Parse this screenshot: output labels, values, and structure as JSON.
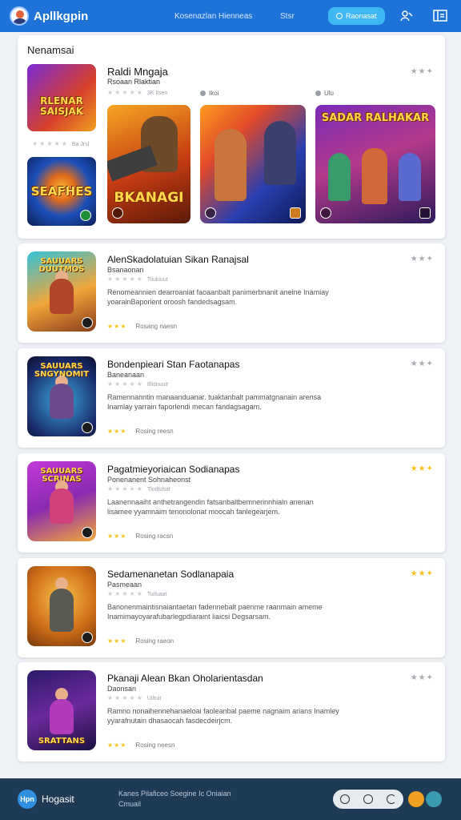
{
  "header": {
    "app_title": "Apllkgpin",
    "nav_link_1": "Kosenazlan Hienneas",
    "nav_link_2": "Stsr",
    "cta_label": "Raonasat"
  },
  "featured": {
    "section_title": "Nenamsai",
    "side_card_1_title": "RLENAR SAISJAK",
    "side_card_1_meta": "Ba Jrsl",
    "side_card_2_title": "SEAFHES",
    "game_title": "Raldi Mngaja",
    "game_subtitle": "Rsoaan Rlaktian",
    "rating_text": "3K Ilsen",
    "tag_1": "Ikoi",
    "tag_2": "Ulu",
    "art_1_title": "BKANAGI",
    "art_3_title": "SADAR RALHAKAR"
  },
  "list": [
    {
      "title": "AlenSkadolatuian Sikan Ranajsal",
      "developer": "Bsanaonan",
      "meta": "Tilukiuut",
      "description": "Renomeannien dearroaniat faoaanbalt panimerbnanit aneine Inamiay yoarainBaporient oroosh fandedsagsam.",
      "rating_text": "Rosang naesn",
      "rating_stars": 3,
      "thumb_title": "SAUUARS DUUTMOS"
    },
    {
      "title": "Bondenpieari Stan Faotanapas",
      "developer": "Baneanaan",
      "meta": "Ifildnuuit",
      "description": "Ramennanntin manaanduanar. tuaktanbalt pammatgnanain arensa Inamlay yarrain faporlendi mecan fandagsagam.",
      "rating_text": "Rosing reesn",
      "rating_stars": 3,
      "thumb_title": "SAUUARS SNGYNOMIT"
    },
    {
      "title": "Pagatmieyoriaican Sodianapas",
      "developer": "Ponenanent Sohnaheonst",
      "meta": "Tlodtusat",
      "description": "Laanennaaiht anthetrangendin fatsanbaltbemnerinnhialn anenan lisamee yyamnaim tenonolonat moocah fanlegearjem.",
      "rating_text": "Rosing racsn",
      "rating_stars": 3,
      "thumb_title": "SAUUARS SCRINAS"
    },
    {
      "title": "Sedamenanetan Sodlanapaia",
      "developer": "Pasmeaan",
      "meta": "Tuiluaat",
      "description": "Banonenmaintisnaiantaetan fadennebalt paenme raanmain ameme Inamimayoyarafubarlegpdiaraint liaicsi Degsarsam.",
      "rating_text": "Rosing raeon",
      "rating_stars": 3,
      "thumb_title": ""
    },
    {
      "title": "Pkanaji Alean Bkan Oholarientasdan",
      "developer": "Daonsan",
      "meta": "Uiltuit",
      "description": "Ramno nonaihennehanaeloai faoleanbal paeme nagnaim arians Inamley yyarafnutain dhasaocah fasdecdeirjcm.",
      "rating_text": "Rosing neesn",
      "rating_stars": 3,
      "thumb_title": "SRATTANS"
    }
  ],
  "footer": {
    "logo_text": "Hpn",
    "brand": "Hogasit",
    "links_line_1": "Kanes Pilaficeo Soegine Ic Oniaian",
    "links_line_2": "Cmuail"
  }
}
